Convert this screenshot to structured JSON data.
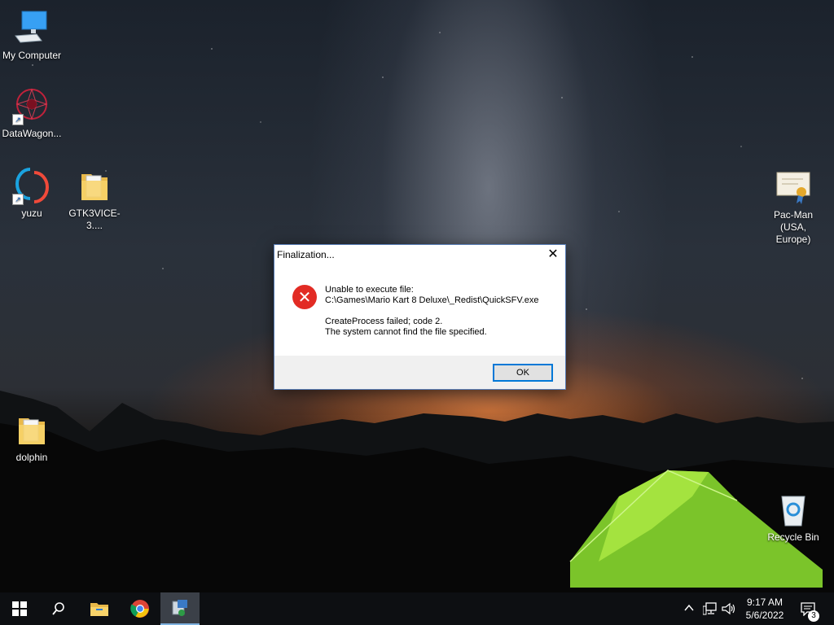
{
  "desktop": {
    "icons": [
      {
        "label": "My Computer",
        "icon": "computer-icon"
      },
      {
        "label": "DataWagon...",
        "icon": "datawagon-icon"
      },
      {
        "label": "yuzu",
        "icon": "yuzu-icon"
      },
      {
        "label": "GTK3VICE-3....",
        "icon": "folder-icon"
      },
      {
        "label": "Pac-Man\n(USA, Europe)",
        "icon": "certificate-file-icon"
      },
      {
        "label": "dolphin",
        "icon": "folder-icon"
      },
      {
        "label": "Recycle Bin",
        "icon": "recycle-bin-icon"
      }
    ]
  },
  "dialog": {
    "title": "Finalization...",
    "close_glyph": "✕",
    "icon": "error-icon",
    "line1": "Unable to execute file:",
    "line2": "C:\\Games\\Mario Kart 8 Deluxe\\_Redist\\QuickSFV.exe",
    "line3": "CreateProcess failed; code 2.",
    "line4": "The system cannot find the file specified.",
    "ok_label": "OK"
  },
  "taskbar": {
    "buttons": [
      {
        "name": "start-button",
        "icon": "windows-logo-icon"
      },
      {
        "name": "search-button",
        "icon": "search-icon"
      },
      {
        "name": "file-explorer-button",
        "icon": "folder-icon"
      },
      {
        "name": "chrome-button",
        "icon": "chrome-icon"
      },
      {
        "name": "installer-button",
        "icon": "installer-icon",
        "active": true
      }
    ],
    "tray": {
      "icons": [
        "chevron-up-icon",
        "network-icon",
        "volume-icon"
      ],
      "time": "9:17 AM",
      "date": "5/6/2022",
      "notification_count": "3"
    }
  },
  "colors": {
    "error_red": "#e22b24",
    "button_focus": "#0078d7",
    "taskbar": "#0d0f12"
  }
}
